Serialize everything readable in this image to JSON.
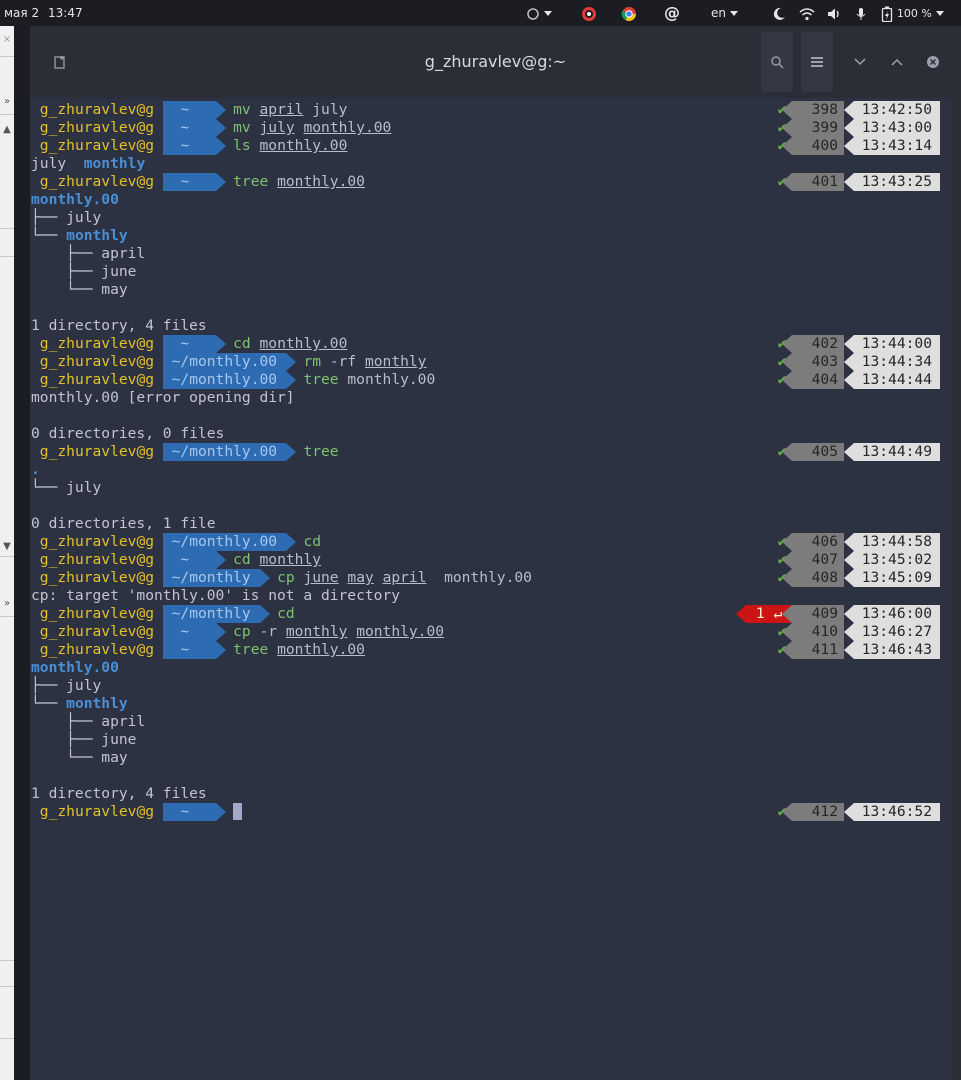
{
  "topbar": {
    "date": "мая 2",
    "time": "13:47",
    "lang": "en",
    "battery": "100 %"
  },
  "window": {
    "title": "g_zhuravlev@g:~"
  },
  "terminal": {
    "user": "g_zhuravlev@g",
    "cwd_home": "~",
    "cwd_monthly": "~/monthly.00",
    "cwd_monthly_short": "~/monthly",
    "cmd": {
      "mv": "mv",
      "ls": "ls",
      "tree": "tree",
      "cd": "cd",
      "rm": "rm",
      "cp": "cp"
    },
    "args": {
      "april": "april",
      "july": "july",
      "monthly00": "monthly.00",
      "monthly": "monthly",
      "june": "june",
      "may": "may",
      "rf": "-rf",
      "r": "-r"
    },
    "output": {
      "ls_result_a": "july",
      "ls_result_b": "monthly",
      "tree_root": "monthly.00",
      "t_july": "├── july",
      "t_monthly_branch": "└── ",
      "t_monthly": "monthly",
      "t_april": "    ├── april",
      "t_june": "    ├── june",
      "t_may": "    └── may",
      "summary_1": "1 directory, 4 files",
      "error_dir": "monthly.00 [error opening dir]",
      "summary_0": "0 directories, 0 files",
      "dot": ".",
      "t2_july": "└── july",
      "summary_01": "0 directories, 1 file",
      "cp_error": "cp: target 'monthly.00' is not a directory",
      "tree2_root": "monthly.00",
      "summary_2": "1 directory, 4 files"
    },
    "right": [
      {
        "num": "398",
        "time": "13:42:50"
      },
      {
        "num": "399",
        "time": "13:43:00"
      },
      {
        "num": "400",
        "time": "13:43:14"
      },
      {
        "num": "401",
        "time": "13:43:25"
      },
      {
        "num": "402",
        "time": "13:44:00"
      },
      {
        "num": "403",
        "time": "13:44:34"
      },
      {
        "num": "404",
        "time": "13:44:44"
      },
      {
        "num": "405",
        "time": "13:44:49"
      },
      {
        "num": "406",
        "time": "13:44:58"
      },
      {
        "num": "407",
        "time": "13:45:02"
      },
      {
        "num": "408",
        "time": "13:45:09"
      },
      {
        "num": "409",
        "time": "13:46:00",
        "error": "1 ↵"
      },
      {
        "num": "410",
        "time": "13:46:27"
      },
      {
        "num": "411",
        "time": "13:46:43"
      },
      {
        "num": "412",
        "time": "13:46:52"
      }
    ],
    "check": "✔"
  }
}
